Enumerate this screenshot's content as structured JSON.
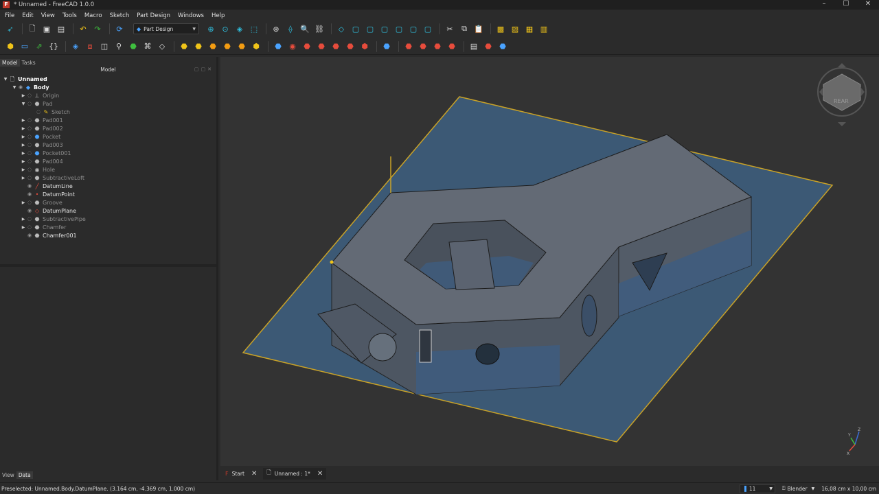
{
  "window": {
    "title": "* Unnamed - FreeCAD 1.0.0",
    "buttons": [
      "–",
      "☐",
      "✕"
    ]
  },
  "menu": [
    "File",
    "Edit",
    "View",
    "Tools",
    "Macro",
    "Sketch",
    "Part Design",
    "Windows",
    "Help"
  ],
  "workbench": {
    "selected": "Part Design"
  },
  "combo_view": {
    "tabs": [
      "Model",
      "Tasks"
    ],
    "header": "Model",
    "tree": [
      {
        "label": "Unnamed",
        "depth": 0,
        "arrow": "▼",
        "icon": "document-icon",
        "style": "bold"
      },
      {
        "label": "Body",
        "depth": 1,
        "arrow": "▼",
        "icon": "body-icon",
        "style": "bold"
      },
      {
        "label": "Origin",
        "depth": 2,
        "arrow": "▶",
        "icon": "origin-icon",
        "style": "dim"
      },
      {
        "label": "Pad",
        "depth": 2,
        "arrow": "▼",
        "icon": "pad-icon",
        "style": "dim"
      },
      {
        "label": "Sketch",
        "depth": 3,
        "arrow": "",
        "icon": "sketch-icon",
        "style": "dim"
      },
      {
        "label": "Pad001",
        "depth": 2,
        "arrow": "▶",
        "icon": "pad-icon",
        "style": "dim"
      },
      {
        "label": "Pad002",
        "depth": 2,
        "arrow": "▶",
        "icon": "pad-icon",
        "style": "dim"
      },
      {
        "label": "Pocket",
        "depth": 2,
        "arrow": "▶",
        "icon": "pocket-icon",
        "style": "dim"
      },
      {
        "label": "Pad003",
        "depth": 2,
        "arrow": "▶",
        "icon": "pad-icon",
        "style": "dim"
      },
      {
        "label": "Pocket001",
        "depth": 2,
        "arrow": "▶",
        "icon": "pocket-icon",
        "style": "dim"
      },
      {
        "label": "Pad004",
        "depth": 2,
        "arrow": "▶",
        "icon": "pad-icon",
        "style": "dim"
      },
      {
        "label": "Hole",
        "depth": 2,
        "arrow": "▶",
        "icon": "hole-icon",
        "style": "dim"
      },
      {
        "label": "SubtractiveLoft",
        "depth": 2,
        "arrow": "▶",
        "icon": "loft-icon",
        "style": "dim"
      },
      {
        "label": "DatumLine",
        "depth": 2,
        "arrow": "",
        "icon": "datum-line-icon",
        "style": "bright"
      },
      {
        "label": "DatumPoint",
        "depth": 2,
        "arrow": "",
        "icon": "datum-point-icon",
        "style": "bright"
      },
      {
        "label": "Groove",
        "depth": 2,
        "arrow": "▶",
        "icon": "groove-icon",
        "style": "dim"
      },
      {
        "label": "DatumPlane",
        "depth": 2,
        "arrow": "",
        "icon": "datum-plane-icon",
        "style": "bright"
      },
      {
        "label": "SubtractivePipe",
        "depth": 2,
        "arrow": "▶",
        "icon": "pipe-icon",
        "style": "dim"
      },
      {
        "label": "Chamfer",
        "depth": 2,
        "arrow": "▶",
        "icon": "chamfer-icon",
        "style": "dim"
      },
      {
        "label": "Chamfer001",
        "depth": 2,
        "arrow": "",
        "icon": "chamfer-icon",
        "style": "bright"
      }
    ],
    "bottom_tabs": [
      "View",
      "Data"
    ]
  },
  "viewport": {
    "navcube_face": "REAR",
    "axis_labels": [
      "Z",
      "Y",
      "X"
    ],
    "colors": {
      "background": "#333333",
      "plane_fill": "#3d5a78",
      "plane_edge": "#c9a227",
      "solid_top": "#636a75"
    }
  },
  "doc_tabs": [
    {
      "label": "Start",
      "icon": "freecad-icon"
    },
    {
      "label": "Unnamed : 1*",
      "icon": "document-icon"
    }
  ],
  "status": {
    "message": "Preselected: Unnamed.Body.DatumPlane. (3.164 cm, -4.369 cm, 1.000 cm)",
    "notifications": "11",
    "navigation_style": "Blender",
    "dimensions": "16,08 cm x 10,00 cm"
  }
}
